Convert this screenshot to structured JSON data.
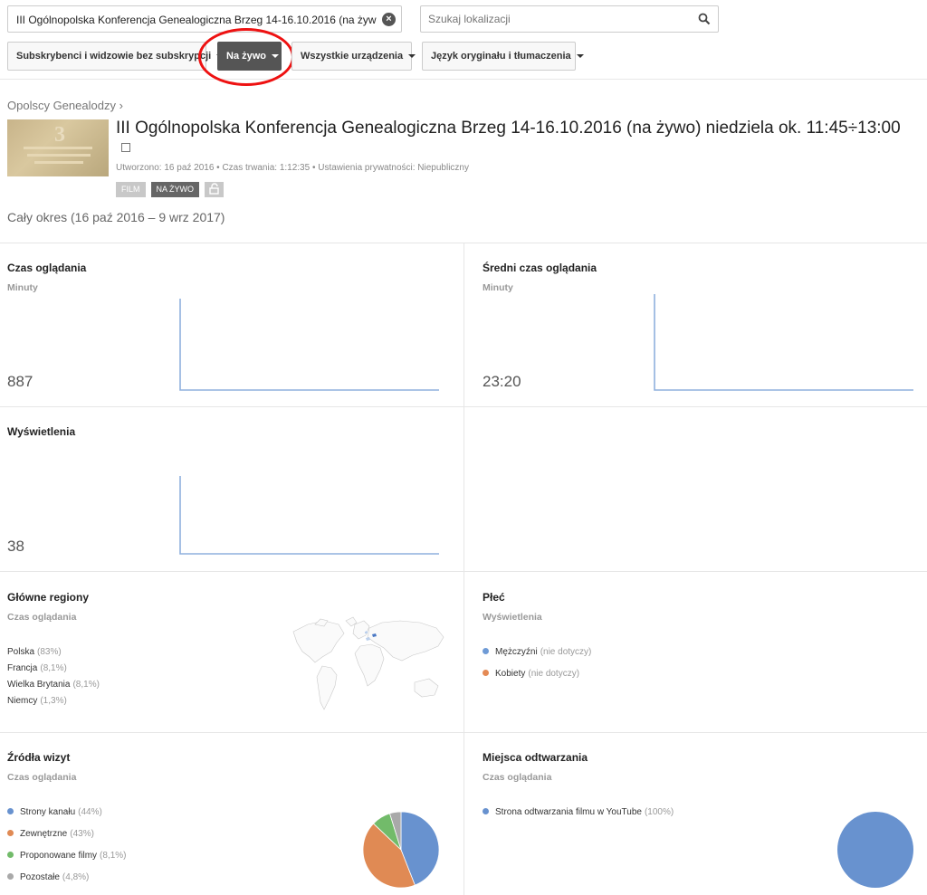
{
  "search": {
    "value": "III Ogólnopolska Konferencja Genealogiczna Brzeg 14-16.10.2016 (na żyw",
    "location_placeholder": "Szukaj lokalizacji"
  },
  "filters": [
    {
      "label": "Subskrybenci i widzowie bez subskrypcji"
    },
    {
      "label": "Na żywo"
    },
    {
      "label": "Wszystkie urządzenia"
    },
    {
      "label": "Język oryginału i tłumaczenia"
    }
  ],
  "channel": "Opolscy Genealodzy ›",
  "video": {
    "title": "III Ogólnopolska Konferencja Genealogiczna Brzeg 14-16.10.2016 (na żywo) niedziela ok. 11:45÷13:00",
    "meta": "Utworzono: 16 paź 2016  •  Czas trwania: 1:12:35  •  Ustawienia prywatności: Niepubliczny",
    "badge_film": "FILM",
    "badge_live": "NA ŻYWO"
  },
  "period": "Cały okres (16 paź 2016 – 9 wrz 2017)",
  "panels": {
    "watch_time": {
      "title": "Czas oglądania",
      "subtitle": "Minuty",
      "value": "887"
    },
    "avg_watch": {
      "title": "Średni czas oglądania",
      "subtitle": "Minuty",
      "value": "23:20"
    },
    "views": {
      "title": "Wyświetlenia",
      "value": "38"
    },
    "regions": {
      "title": "Główne regiony",
      "subtitle": "Czas oglądania",
      "items": [
        {
          "name": "Polska",
          "pct": "(83%)"
        },
        {
          "name": "Francja",
          "pct": "(8,1%)"
        },
        {
          "name": "Wielka Brytania",
          "pct": "(8,1%)"
        },
        {
          "name": "Niemcy",
          "pct": "(1,3%)"
        }
      ]
    },
    "gender": {
      "title": "Płeć",
      "subtitle": "Wyświetlenia",
      "items": [
        {
          "name": "Mężczyźni",
          "pct": "(nie dotyczy)",
          "color": "#6f9bd6"
        },
        {
          "name": "Kobiety",
          "pct": "(nie dotyczy)",
          "color": "#e48a55"
        }
      ]
    },
    "sources": {
      "title": "Źródła wizyt",
      "subtitle": "Czas oglądania",
      "items": [
        {
          "name": "Strony kanału",
          "pct": "(44%)",
          "value": 44,
          "color": "#6892cf"
        },
        {
          "name": "Zewnętrzne",
          "pct": "(43%)",
          "value": 43,
          "color": "#e08a54"
        },
        {
          "name": "Proponowane filmy",
          "pct": "(8,1%)",
          "value": 8.1,
          "color": "#72bb6a"
        },
        {
          "name": "Pozostałe",
          "pct": "(4,8%)",
          "value": 4.8,
          "color": "#a9a9a9"
        }
      ]
    },
    "playback": {
      "title": "Miejsca odtwarzania",
      "subtitle": "Czas oglądania",
      "items": [
        {
          "name": "Strona odtwarzania filmu w YouTube",
          "pct": "(100%)",
          "value": 100,
          "color": "#6892cf"
        }
      ]
    }
  },
  "colors": {
    "line": "#8fb0dd",
    "active_filter": "#555555",
    "highlight": "#e11111"
  }
}
